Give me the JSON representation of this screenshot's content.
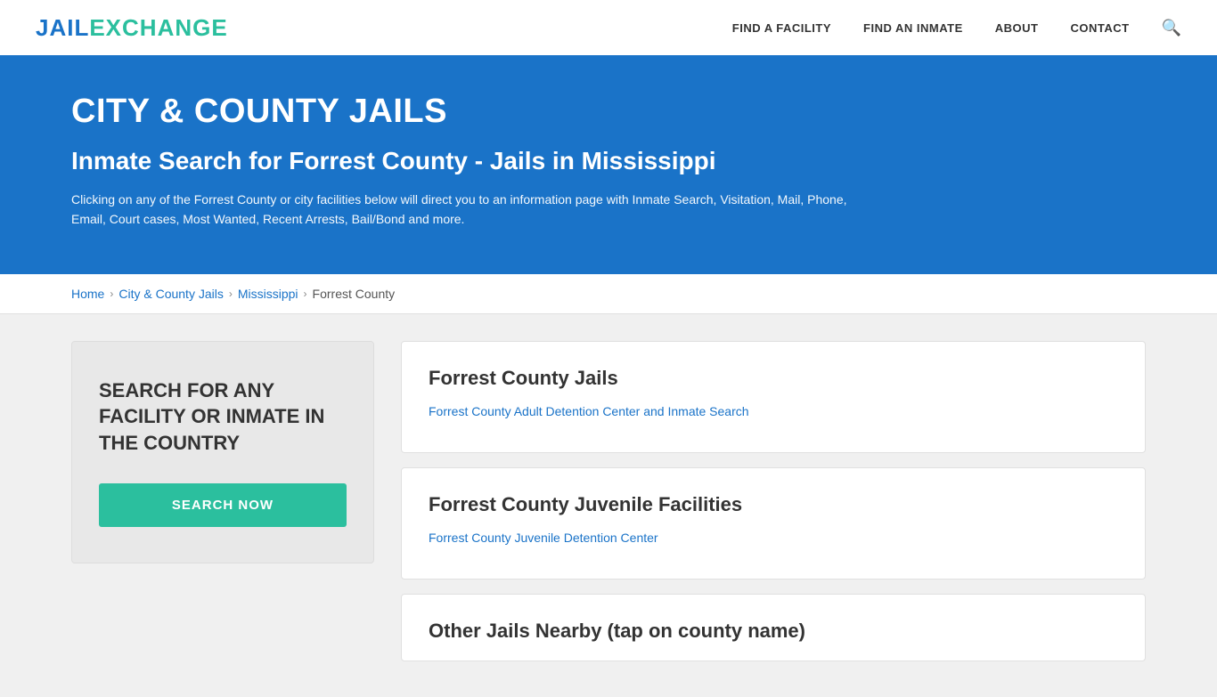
{
  "header": {
    "logo_jail": "JAIL",
    "logo_exchange": "EXCHANGE",
    "nav": [
      {
        "label": "FIND A FACILITY",
        "id": "find-facility"
      },
      {
        "label": "FIND AN INMATE",
        "id": "find-inmate"
      },
      {
        "label": "ABOUT",
        "id": "about"
      },
      {
        "label": "CONTACT",
        "id": "contact"
      }
    ],
    "search_icon": "🔍"
  },
  "hero": {
    "title": "CITY & COUNTY JAILS",
    "subtitle": "Inmate Search for Forrest County - Jails in Mississippi",
    "description": "Clicking on any of the Forrest County or city facilities below will direct you to an information page with Inmate Search, Visitation, Mail, Phone, Email, Court cases, Most Wanted, Recent Arrests, Bail/Bond and more."
  },
  "breadcrumb": {
    "items": [
      {
        "label": "Home",
        "link": true
      },
      {
        "label": "City & County Jails",
        "link": true
      },
      {
        "label": "Mississippi",
        "link": true
      },
      {
        "label": "Forrest County",
        "link": false
      }
    ]
  },
  "left_panel": {
    "text": "SEARCH FOR ANY FACILITY OR INMATE IN THE COUNTRY",
    "button_label": "SEARCH NOW"
  },
  "facility_cards": [
    {
      "id": "jails",
      "title": "Forrest County Jails",
      "links": [
        {
          "label": "Forrest County Adult Detention Center and Inmate Search",
          "href": "#"
        }
      ]
    },
    {
      "id": "juvenile",
      "title": "Forrest County Juvenile Facilities",
      "links": [
        {
          "label": "Forrest County Juvenile Detention Center",
          "href": "#"
        }
      ]
    },
    {
      "id": "other",
      "title": "Other Jails Nearby (tap on county name)",
      "links": []
    }
  ]
}
